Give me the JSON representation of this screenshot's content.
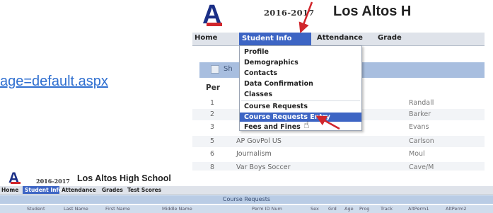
{
  "url_fragment": "age=default.aspx",
  "top": {
    "logo_letter": "A",
    "year": "2016-2017",
    "school": "Los Altos H",
    "menu": [
      "Home",
      "Student Info",
      "Attendance",
      "Grade"
    ],
    "dropdown": [
      "Profile",
      "Demographics",
      "Contacts",
      "Data Confirmation",
      "Classes",
      "Course Requests",
      "Course Requests Entry",
      "Fees and Fines"
    ],
    "dropdown_highlighted": "Course Requests Entry",
    "panel_label": "Sh",
    "per_header": "Per",
    "periods": [
      {
        "per": "1",
        "course": "",
        "teacher": "Randall"
      },
      {
        "per": "2",
        "course": "",
        "teacher": "Barker"
      },
      {
        "per": "3",
        "course": "",
        "teacher": "Evans"
      },
      {
        "per": "5",
        "course": "AP GovPol US",
        "teacher": "Carlson"
      },
      {
        "per": "6",
        "course": "Journalism",
        "teacher": "Moul"
      },
      {
        "per": "8",
        "course": "Var Boys Soccer",
        "teacher": "Cave/M"
      }
    ]
  },
  "bottom": {
    "year": "2016-2017",
    "school": "Los Altos High School",
    "menu": [
      "Home",
      "Student Info",
      "Attendance",
      "Grades",
      "Test Scores"
    ],
    "section_title": "Course Requests",
    "columns": [
      "Student",
      "Last Name",
      "First Name",
      "Middle Name",
      "Perm ID Num",
      "Sex",
      "Grd",
      "Age",
      "Prog",
      "Track",
      "AltPerm1",
      "AltPerm2"
    ]
  },
  "colors": {
    "logo_blue": "#1b2f86",
    "logo_red": "#d1262c",
    "menu_highlight": "#3d65c4",
    "link": "#2f6fd0",
    "arrow_red": "#d1262c"
  }
}
